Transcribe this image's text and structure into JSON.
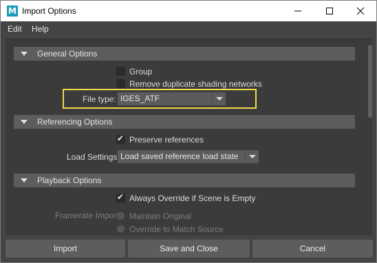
{
  "window": {
    "title": "Import Options",
    "app_icon_letter": "M"
  },
  "menu": {
    "items": [
      "Edit",
      "Help"
    ]
  },
  "sections": {
    "general": {
      "title": "General Options",
      "group_label": "Group",
      "remove_dup_label": "Remove duplicate shading networks",
      "file_type_label": "File type:",
      "file_type_value": "IGES_ATF"
    },
    "referencing": {
      "title": "Referencing Options",
      "preserve_label": "Preserve references",
      "load_settings_label": "Load Settings",
      "load_settings_value": "Load saved reference load state"
    },
    "playback": {
      "title": "Playback Options",
      "always_override_label": "Always Override if Scene is Empty",
      "framerate_label": "Framerate Import",
      "maintain_label": "Maintain Original",
      "override_label": "Override to Match Source"
    }
  },
  "footer": {
    "import_label": "Import",
    "save_close_label": "Save and Close",
    "cancel_label": "Cancel"
  },
  "colors": {
    "highlight": "#f2d94b",
    "app_icon": "#1b9bb5",
    "panel": "#3b3b3b",
    "header": "#5d5d5d"
  }
}
